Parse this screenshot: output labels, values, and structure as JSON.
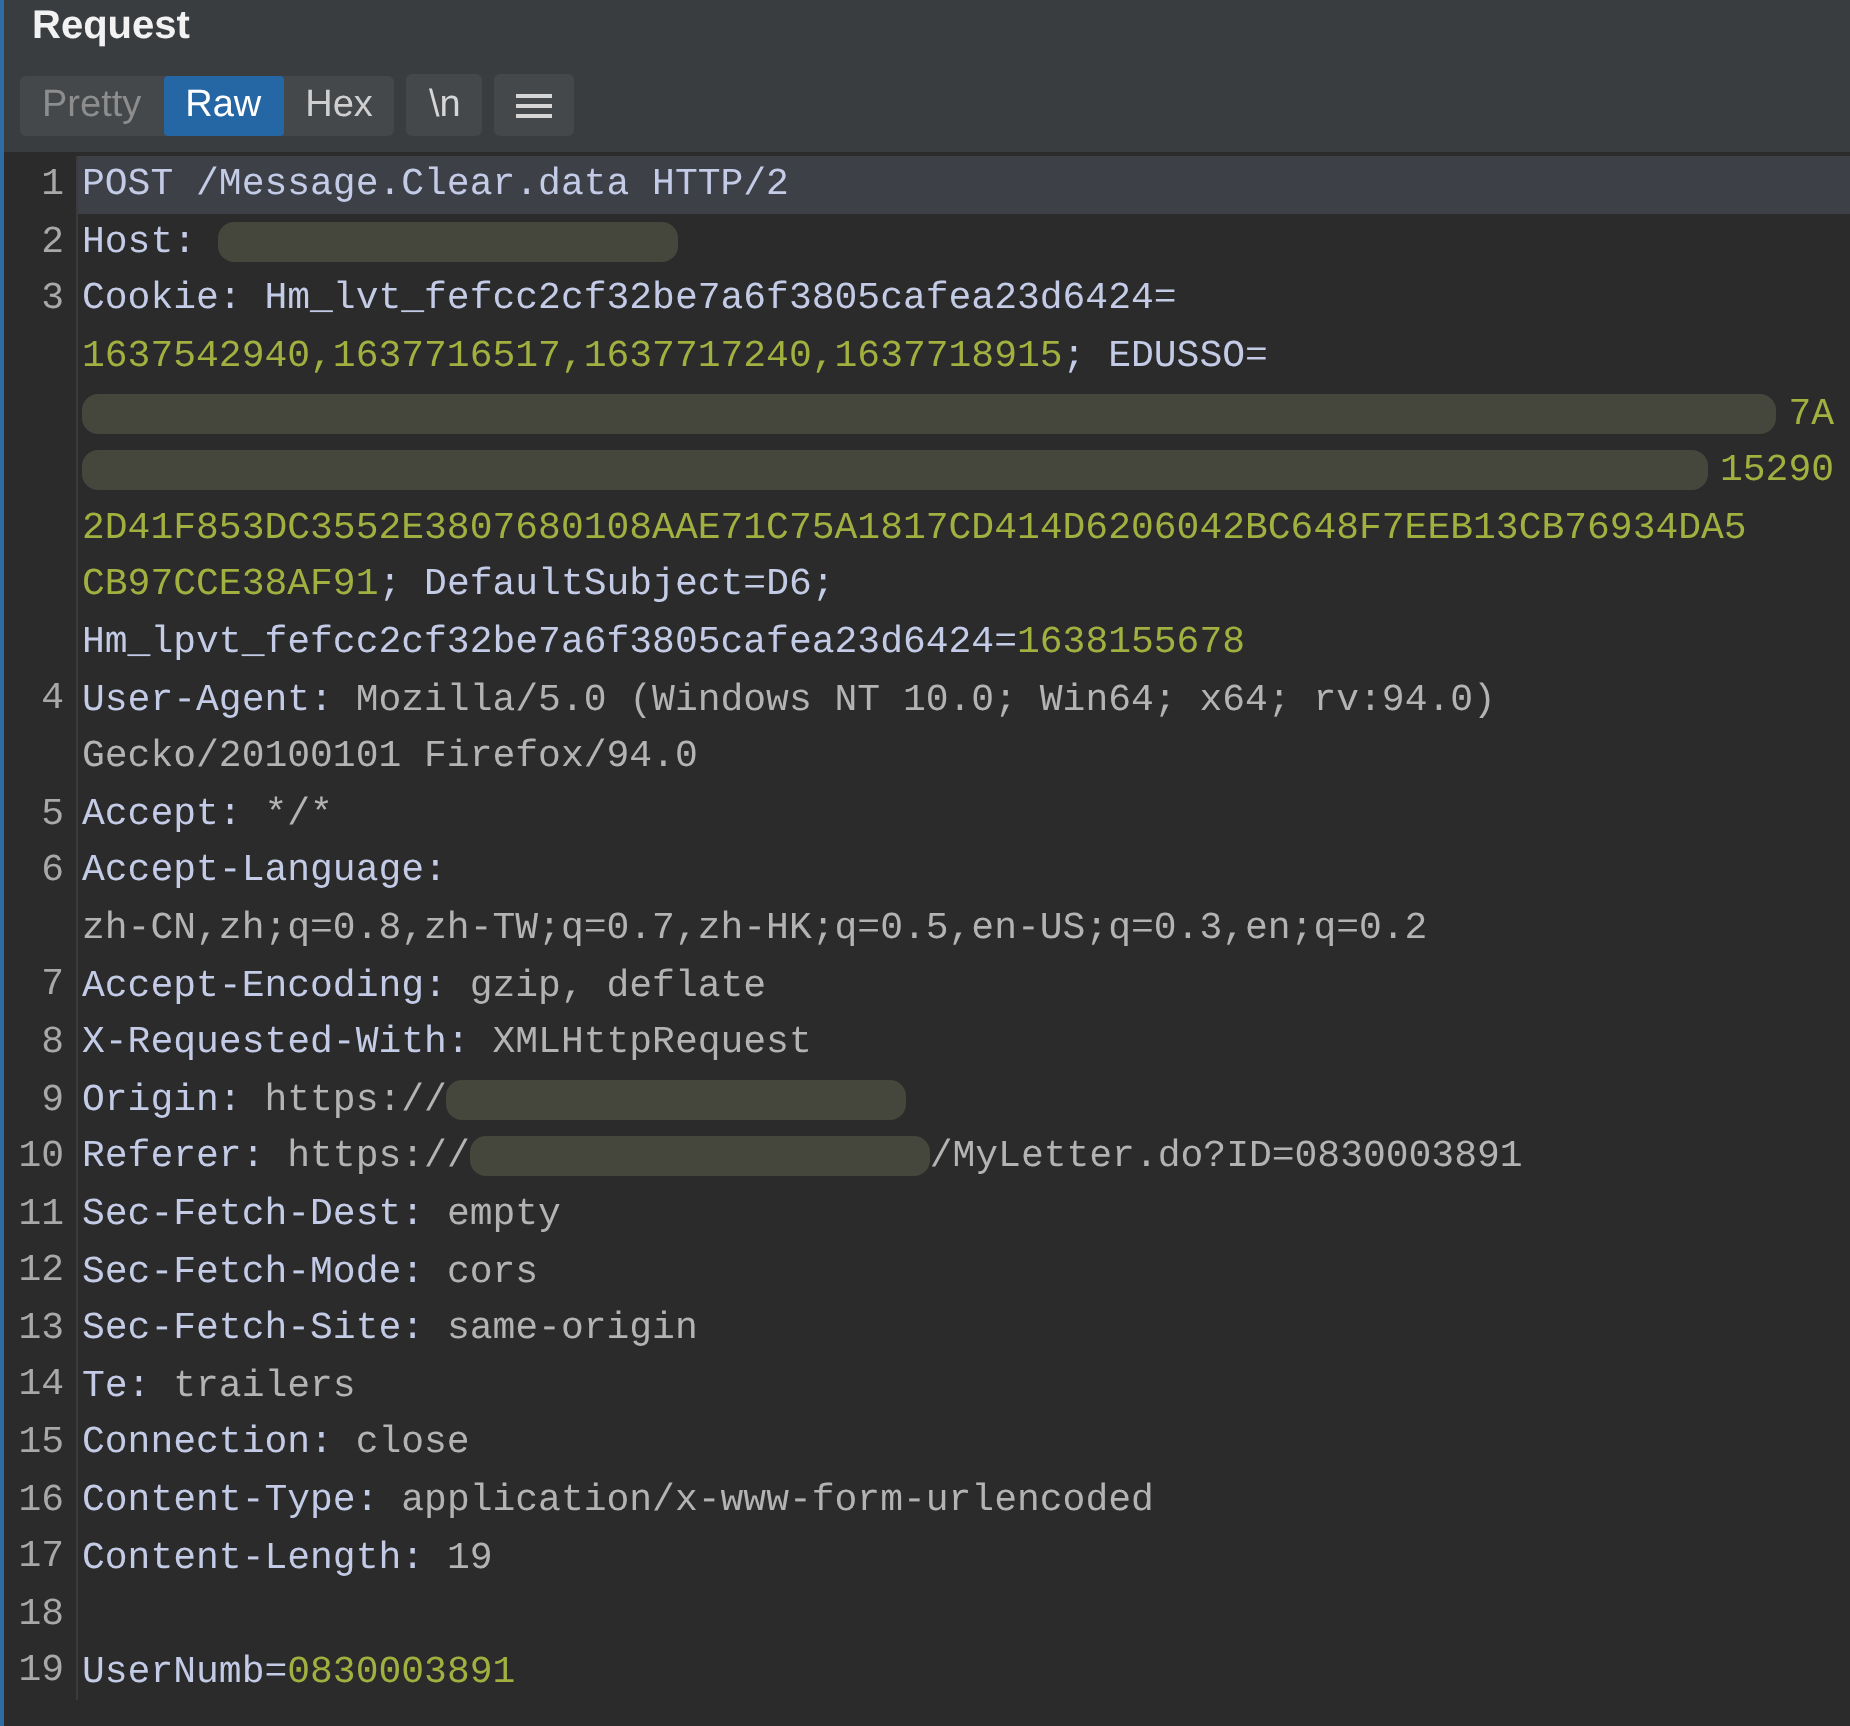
{
  "panel": {
    "title": "Request"
  },
  "view_tabs": [
    {
      "label": "Pretty",
      "selected": false
    },
    {
      "label": "Raw",
      "selected": true
    },
    {
      "label": "Hex",
      "selected": false
    }
  ],
  "toolbar_buttons": [
    {
      "kind": "text",
      "label": "\\n"
    },
    {
      "kind": "menu"
    }
  ],
  "editor": {
    "lines": [
      {
        "number": "1",
        "current": true,
        "wrapped_rows": [
          {
            "segments": [
              {
                "kind": "name",
                "text": "POST /Message.Clear.data HTTP/2"
              }
            ]
          }
        ]
      },
      {
        "number": "2",
        "current": false,
        "wrapped_rows": [
          {
            "segments": [
              {
                "kind": "name",
                "text": "Host: "
              },
              {
                "kind": "redacted"
              }
            ]
          }
        ]
      },
      {
        "number": "3",
        "current": false,
        "wrapped_rows": [
          {
            "segments": [
              {
                "kind": "name",
                "text": "Cookie: Hm_lvt_fefcc2cf32be7a6f3805cafea23d6424="
              }
            ]
          },
          {
            "segments": [
              {
                "kind": "number",
                "text": "1637542940,1637716517,1637717240,1637718915"
              },
              {
                "kind": "name",
                "text": "; EDUSSO="
              }
            ]
          },
          {
            "segments": [
              {
                "kind": "redacted_fill"
              },
              {
                "kind": "number",
                "text": "7A"
              }
            ]
          },
          {
            "segments": [
              {
                "kind": "redacted_fill"
              },
              {
                "kind": "number",
                "text": "15290"
              }
            ]
          },
          {
            "segments": [
              {
                "kind": "number",
                "text": "2D41F853DC3552E3807680108AAE71C75A1817CD414D6206042BC648F7EEB13CB76934DA5"
              }
            ]
          },
          {
            "segments": [
              {
                "kind": "number",
                "text": "CB97CCE38AF91"
              },
              {
                "kind": "name",
                "text": "; DefaultSubject=D6;"
              }
            ]
          },
          {
            "segments": [
              {
                "kind": "name",
                "text": "Hm_lpvt_fefcc2cf32be7a6f3805cafea23d6424="
              },
              {
                "kind": "number",
                "text": "1638155678"
              }
            ]
          }
        ]
      },
      {
        "number": "4",
        "current": false,
        "wrapped_rows": [
          {
            "segments": [
              {
                "kind": "name",
                "text": "User-Agent: "
              },
              {
                "kind": "value",
                "text": "Mozilla/5.0 (Windows NT 10.0; Win64; x64; rv:94.0)"
              }
            ]
          },
          {
            "segments": [
              {
                "kind": "value",
                "text": "Gecko/20100101 Firefox/94.0"
              }
            ]
          }
        ]
      },
      {
        "number": "5",
        "current": false,
        "wrapped_rows": [
          {
            "segments": [
              {
                "kind": "name",
                "text": "Accept: "
              },
              {
                "kind": "value",
                "text": "*/*"
              }
            ]
          }
        ]
      },
      {
        "number": "6",
        "current": false,
        "wrapped_rows": [
          {
            "segments": [
              {
                "kind": "name",
                "text": "Accept-Language:"
              }
            ]
          },
          {
            "segments": [
              {
                "kind": "value",
                "text": "zh-CN,zh;q=0.8,zh-TW;q=0.7,zh-HK;q=0.5,en-US;q=0.3,en;q=0.2"
              }
            ]
          }
        ]
      },
      {
        "number": "7",
        "current": false,
        "wrapped_rows": [
          {
            "segments": [
              {
                "kind": "name",
                "text": "Accept-Encoding: "
              },
              {
                "kind": "value",
                "text": "gzip, deflate"
              }
            ]
          }
        ]
      },
      {
        "number": "8",
        "current": false,
        "wrapped_rows": [
          {
            "segments": [
              {
                "kind": "name",
                "text": "X-Requested-With: "
              },
              {
                "kind": "value",
                "text": "XMLHttpRequest"
              }
            ]
          }
        ]
      },
      {
        "number": "9",
        "current": false,
        "wrapped_rows": [
          {
            "segments": [
              {
                "kind": "name",
                "text": "Origin: "
              },
              {
                "kind": "value",
                "text": "https://"
              },
              {
                "kind": "redacted"
              }
            ]
          }
        ]
      },
      {
        "number": "10",
        "current": false,
        "wrapped_rows": [
          {
            "segments": [
              {
                "kind": "name",
                "text": "Referer: "
              },
              {
                "kind": "value",
                "text": "https://"
              },
              {
                "kind": "redacted"
              },
              {
                "kind": "value",
                "text": "/MyLetter.do?ID=0830003891"
              }
            ]
          }
        ]
      },
      {
        "number": "11",
        "current": false,
        "wrapped_rows": [
          {
            "segments": [
              {
                "kind": "name",
                "text": "Sec-Fetch-Dest: "
              },
              {
                "kind": "value",
                "text": "empty"
              }
            ]
          }
        ]
      },
      {
        "number": "12",
        "current": false,
        "wrapped_rows": [
          {
            "segments": [
              {
                "kind": "name",
                "text": "Sec-Fetch-Mode: "
              },
              {
                "kind": "value",
                "text": "cors"
              }
            ]
          }
        ]
      },
      {
        "number": "13",
        "current": false,
        "wrapped_rows": [
          {
            "segments": [
              {
                "kind": "name",
                "text": "Sec-Fetch-Site: "
              },
              {
                "kind": "value",
                "text": "same-origin"
              }
            ]
          }
        ]
      },
      {
        "number": "14",
        "current": false,
        "wrapped_rows": [
          {
            "segments": [
              {
                "kind": "name",
                "text": "Te: "
              },
              {
                "kind": "value",
                "text": "trailers"
              }
            ]
          }
        ]
      },
      {
        "number": "15",
        "current": false,
        "wrapped_rows": [
          {
            "segments": [
              {
                "kind": "name",
                "text": "Connection: "
              },
              {
                "kind": "value",
                "text": "close"
              }
            ]
          }
        ]
      },
      {
        "number": "16",
        "current": false,
        "wrapped_rows": [
          {
            "segments": [
              {
                "kind": "name",
                "text": "Content-Type: "
              },
              {
                "kind": "value",
                "text": "application/x-www-form-urlencoded"
              }
            ]
          }
        ]
      },
      {
        "number": "17",
        "current": false,
        "wrapped_rows": [
          {
            "segments": [
              {
                "kind": "name",
                "text": "Content-Length: "
              },
              {
                "kind": "value",
                "text": "19"
              }
            ]
          }
        ]
      },
      {
        "number": "18",
        "current": false
      },
      {
        "number": "19",
        "current": false,
        "wrapped_rows": [
          {
            "segments": [
              {
                "kind": "name",
                "text": "UserNumb="
              },
              {
                "kind": "number",
                "text": "0830003891"
              }
            ]
          }
        ]
      }
    ]
  }
}
